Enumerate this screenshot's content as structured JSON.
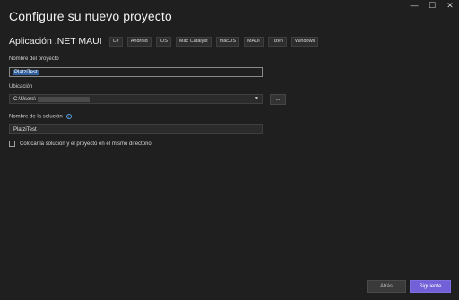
{
  "window": {
    "controls": [
      "—",
      "☐",
      "✕"
    ]
  },
  "page": {
    "title": "Configure su nuevo proyecto"
  },
  "template": {
    "name": "Aplicación .NET MAUI",
    "tags": [
      "C#",
      "Android",
      "iOS",
      "Mac Catalyst",
      "macOS",
      "MAUI",
      "Tizen",
      "Windows"
    ]
  },
  "form": {
    "project_name_label": "Nombre del proyecto",
    "project_name_value": "PlatziTest",
    "location_label": "Ubicación",
    "location_value": "C:\\Users\\",
    "browse_label": "...",
    "solution_name_label": "Nombre de la solución",
    "solution_name_value": "PlatziTest",
    "same_directory_label": "Colocar la solución y el proyecto en el mismo directorio"
  },
  "footer": {
    "back_label": "Atrás",
    "next_label": "Siguiente"
  },
  "colors": {
    "background": "#1f1f1f",
    "accent": "#7160d8",
    "selection": "#2f5f9c"
  }
}
